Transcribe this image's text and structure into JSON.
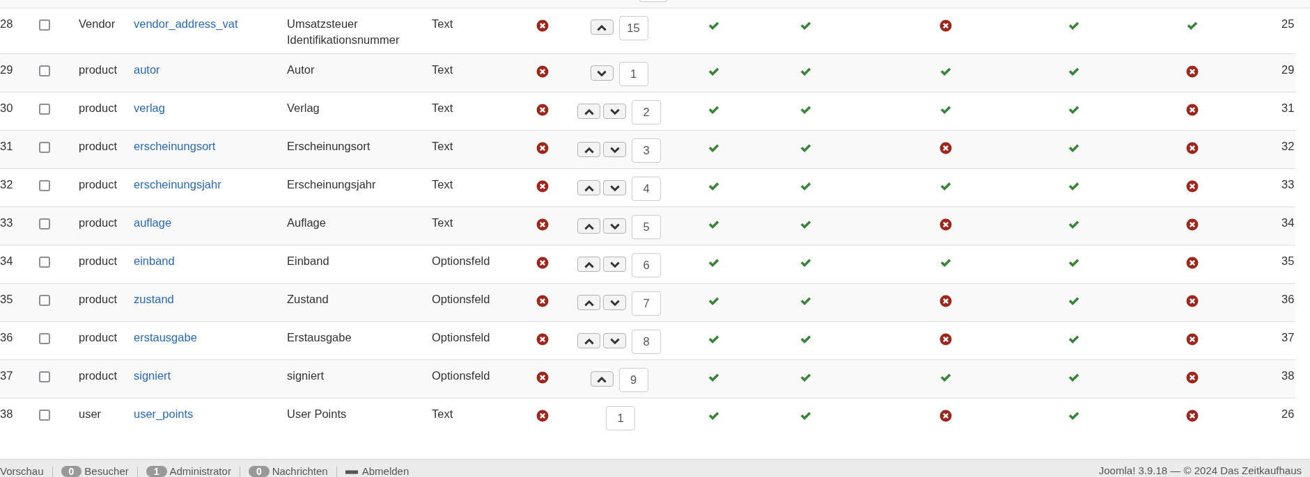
{
  "rows": [
    {
      "number": "28",
      "checked": false,
      "group": "Vendor",
      "name": "vendor_address_vat",
      "label": "Umsatzsteuer Identifikationsnummer",
      "type": "Text",
      "marks": [
        false,
        true,
        true,
        false,
        true,
        true
      ],
      "ordering": {
        "up": true,
        "down": false,
        "value": "15"
      },
      "column_last": "25"
    },
    {
      "number": "29",
      "checked": false,
      "group": "product",
      "name": "autor",
      "label": "Autor",
      "type": "Text",
      "marks": [
        false,
        true,
        true,
        true,
        true,
        false
      ],
      "ordering": {
        "up": false,
        "down": true,
        "value": "1"
      },
      "column_last": "29"
    },
    {
      "number": "30",
      "checked": false,
      "group": "product",
      "name": "verlag",
      "label": "Verlag",
      "type": "Text",
      "marks": [
        false,
        true,
        true,
        true,
        true,
        false
      ],
      "ordering": {
        "up": true,
        "down": true,
        "value": "2"
      },
      "column_last": "31"
    },
    {
      "number": "31",
      "checked": false,
      "group": "product",
      "name": "erscheinungsort",
      "label": "Erscheinungsort",
      "type": "Text",
      "marks": [
        false,
        true,
        true,
        false,
        true,
        false
      ],
      "ordering": {
        "up": true,
        "down": true,
        "value": "3"
      },
      "column_last": "32"
    },
    {
      "number": "32",
      "checked": false,
      "group": "product",
      "name": "erscheinungsjahr",
      "label": "Erscheinungsjahr",
      "type": "Text",
      "marks": [
        false,
        true,
        true,
        true,
        true,
        false
      ],
      "ordering": {
        "up": true,
        "down": true,
        "value": "4"
      },
      "column_last": "33"
    },
    {
      "number": "33",
      "checked": false,
      "group": "product",
      "name": "auflage",
      "label": "Auflage",
      "type": "Text",
      "marks": [
        false,
        true,
        true,
        false,
        true,
        false
      ],
      "ordering": {
        "up": true,
        "down": true,
        "value": "5"
      },
      "column_last": "34"
    },
    {
      "number": "34",
      "checked": false,
      "group": "product",
      "name": "einband",
      "label": "Einband",
      "type": "Optionsfeld",
      "marks": [
        false,
        true,
        true,
        true,
        true,
        false
      ],
      "ordering": {
        "up": true,
        "down": true,
        "value": "6"
      },
      "column_last": "35"
    },
    {
      "number": "35",
      "checked": false,
      "group": "product",
      "name": "zustand",
      "label": "Zustand",
      "type": "Optionsfeld",
      "marks": [
        false,
        true,
        true,
        false,
        true,
        false
      ],
      "ordering": {
        "up": true,
        "down": true,
        "value": "7"
      },
      "column_last": "36"
    },
    {
      "number": "36",
      "checked": false,
      "group": "product",
      "name": "erstausgabe",
      "label": "Erstausgabe",
      "type": "Optionsfeld",
      "marks": [
        false,
        true,
        true,
        false,
        true,
        false
      ],
      "ordering": {
        "up": true,
        "down": true,
        "value": "8"
      },
      "column_last": "37"
    },
    {
      "number": "37",
      "checked": false,
      "group": "product",
      "name": "signiert",
      "label": "signiert",
      "type": "Optionsfeld",
      "marks": [
        false,
        true,
        true,
        true,
        true,
        false
      ],
      "ordering": {
        "up": true,
        "down": false,
        "value": "9"
      },
      "column_last": "38"
    },
    {
      "number": "38",
      "checked": false,
      "group": "user",
      "name": "user_points",
      "label": "User Points",
      "type": "Text",
      "marks": [
        false,
        true,
        true,
        false,
        true,
        false
      ],
      "ordering": {
        "up": false,
        "down": false,
        "value": "1"
      },
      "column_last": "26"
    }
  ],
  "status_bar": {
    "items": [
      {
        "kind": "link",
        "label": "Vorschau"
      },
      {
        "kind": "count",
        "count": "0",
        "label": "Besucher"
      },
      {
        "kind": "count",
        "count": "1",
        "label": "Administrator"
      },
      {
        "kind": "count",
        "count": "0",
        "label": "Nachrichten"
      },
      {
        "kind": "logout",
        "label": "Abmelden"
      }
    ],
    "copyright": "Joomla! 3.9.18  —  © 2024 Das Zeitkaufhaus"
  }
}
